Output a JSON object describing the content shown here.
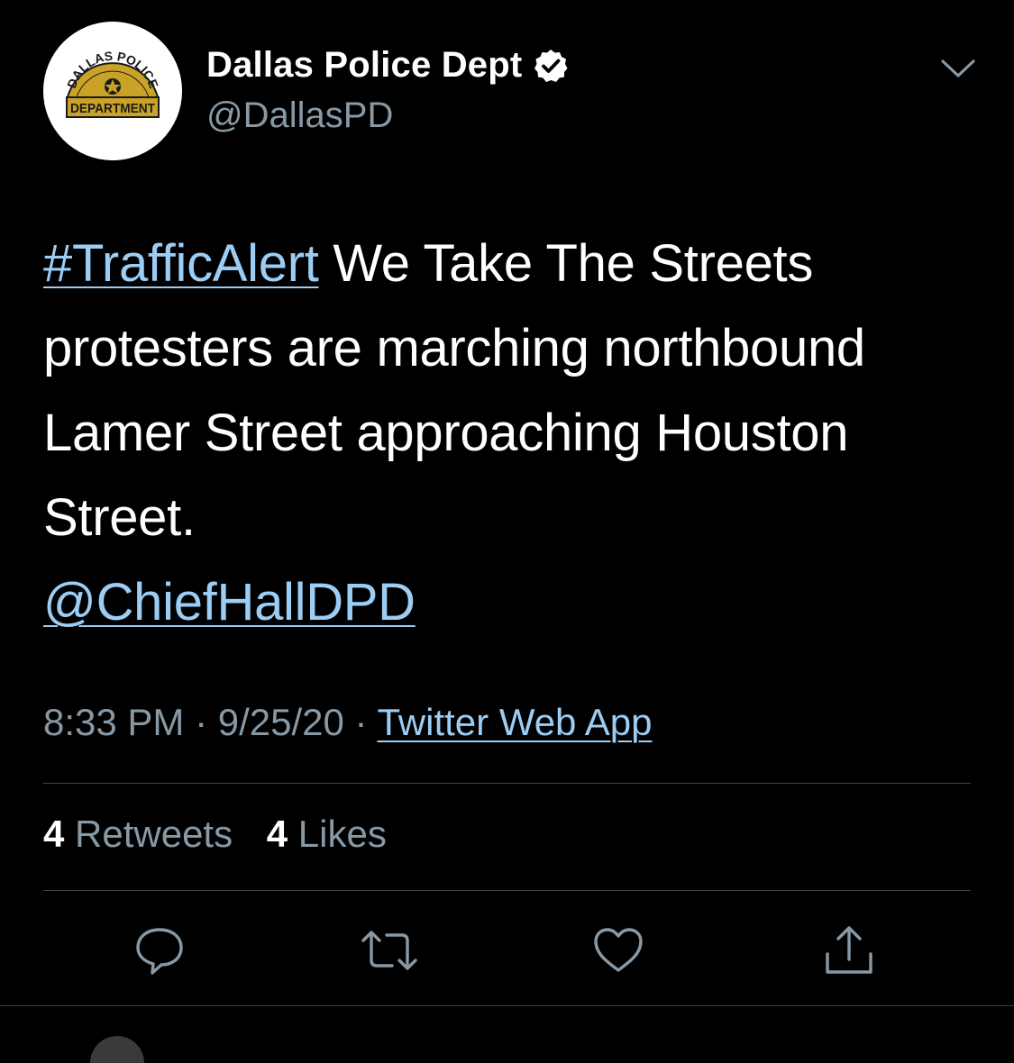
{
  "account": {
    "display_name": "Dallas Police Dept",
    "handle": "@DallasPD",
    "verified": true,
    "avatar_logo_text_top": "DALLAS POLICE",
    "avatar_logo_text_bottom": "DEPARTMENT"
  },
  "tweet": {
    "hashtag": "#TrafficAlert",
    "line1_rest": " We Take The Streets",
    "line2": "protesters are marching northbound",
    "line3": "Lamer Street approaching Houston",
    "line4": "Street.",
    "mention": "@ChiefHallDPD"
  },
  "meta": {
    "time": "8:33 PM",
    "separator1": " · ",
    "date": "9/25/20",
    "separator2": " · ",
    "source": "Twitter Web App"
  },
  "stats": {
    "retweets_count": "4",
    "retweets_label": " Retweets",
    "likes_count": "4",
    "likes_label": " Likes"
  },
  "actions": [
    "reply-icon",
    "retweet-icon",
    "like-icon",
    "share-icon"
  ],
  "colors": {
    "background": "#000000",
    "link": "#9ccdf5",
    "secondary_text": "#8899a6",
    "divider": "#38444d",
    "badge_logo_gold": "#c9a227"
  }
}
